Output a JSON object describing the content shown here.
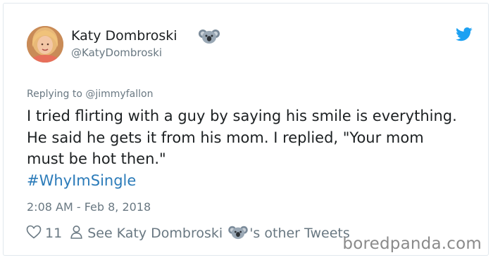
{
  "tweet": {
    "display_name": "Katy Dombroski",
    "handle": "@KatyDombroski",
    "reply_to": "Replying to @jimmyfallon",
    "text": "I tried flirting with a guy by saying his smile is everything. He said he gets it from his mom. I replied, \"Your mom must be hot then.\"",
    "hashtag": "#WhyImSingle",
    "timestamp": "2:08 AM - Feb 8, 2018"
  },
  "actions": {
    "like_count": "11",
    "see_profile_label": "See Katy Dombroski",
    "other_tweets_suffix": "'s other Tweets"
  },
  "watermark": "boredpanda.com",
  "icons": {
    "display_name_emoji": "koala-icon",
    "brand": "twitter-bird-icon",
    "like": "heart-icon",
    "profile": "person-icon"
  },
  "colors": {
    "hashtag": "#2b7bb9",
    "twitter_blue": "#1da1f2",
    "secondary_text": "#697882",
    "primary_text": "#1c2022",
    "border": "#e1e8ed"
  }
}
